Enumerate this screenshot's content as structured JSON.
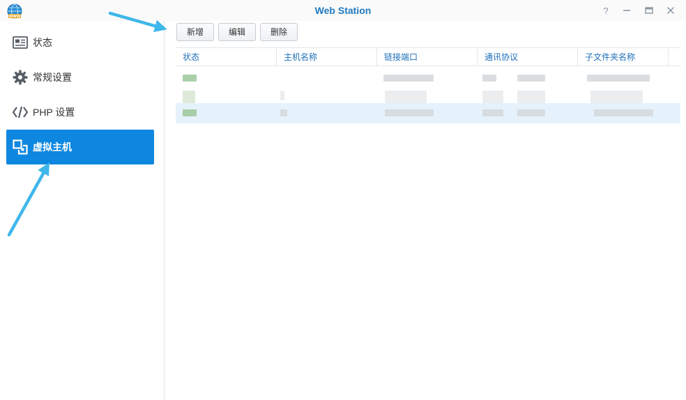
{
  "window": {
    "title": "Web Station"
  },
  "window_controls": {
    "help": "?",
    "minimize": "—",
    "maximize": "▭",
    "close": "✕"
  },
  "sidebar": {
    "items": [
      {
        "label": "状态",
        "icon": "status-card-icon",
        "active": false
      },
      {
        "label": "常规设置",
        "icon": "gear-icon",
        "active": false
      },
      {
        "label": "PHP 设置",
        "icon": "code-icon",
        "active": false
      },
      {
        "label": "虚拟主机",
        "icon": "virtual-host-icon",
        "active": true
      }
    ]
  },
  "toolbar": {
    "add_label": "新增",
    "edit_label": "编辑",
    "delete_label": "删除"
  },
  "table": {
    "columns": [
      "状态",
      "主机名称",
      "链接端口",
      "通讯协议",
      "子文件夹名称"
    ],
    "rows_count_note": "",
    "selected_row": 2
  },
  "colors": {
    "accent": "#0d87e0",
    "title": "#1e79bf",
    "header_text": "#1d6fb8",
    "arrow": "#3fb7ea"
  }
}
